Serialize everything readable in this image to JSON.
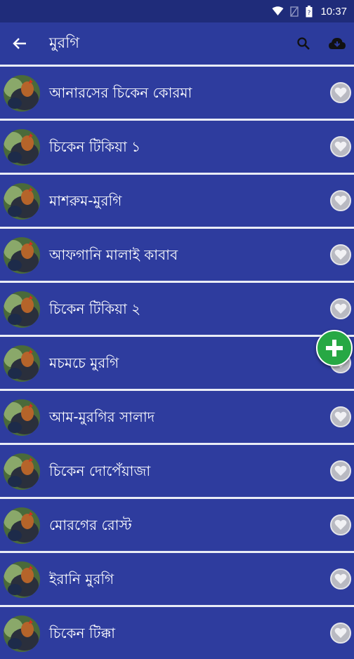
{
  "status_bar": {
    "time": "10:37"
  },
  "app_bar": {
    "title": "মুরগি"
  },
  "recipes": [
    {
      "label": "আনারসের চিকেন কোরমা"
    },
    {
      "label": "চিকেন টিকিয়া ১"
    },
    {
      "label": "মাশরুম-মুরগি"
    },
    {
      "label": "আফগানি মালাই কাবাব"
    },
    {
      "label": "চিকেন টিকিয়া ২"
    },
    {
      "label": "মচমচে মুরগি"
    },
    {
      "label": "আম-মুরগির সালাদ"
    },
    {
      "label": "চিকেন দোপেঁয়াজা"
    },
    {
      "label": "মোরগের রোস্ট"
    },
    {
      "label": "ইরানি মুরগি"
    },
    {
      "label": "চিকেন টিক্কা"
    }
  ],
  "icons": {
    "back": "arrow-left-icon",
    "search": "search-icon",
    "download": "cloud-download-icon",
    "favorite": "heart-icon",
    "add": "plus-icon"
  },
  "colors": {
    "app_bar": "#2c3b9c",
    "status_bar": "#1f2c7a",
    "list_background": "#2e3c9e",
    "fab": "#27a844"
  }
}
